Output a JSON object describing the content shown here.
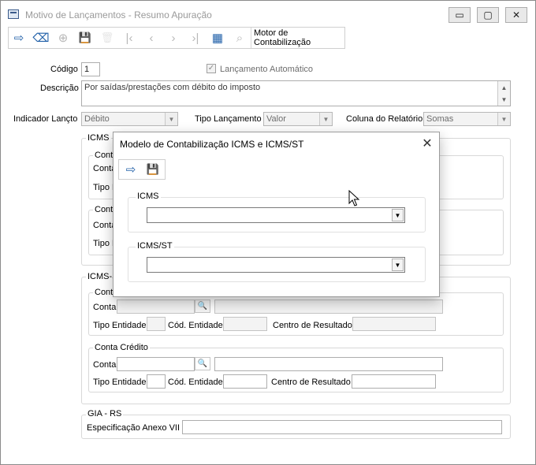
{
  "window": {
    "title": "Motivo de Lançamentos - Resumo Apuração",
    "minimize_glyph": "▭",
    "maximize_glyph": "▢",
    "close_glyph": "✕"
  },
  "toolbar": {
    "exit_icon": "⇨",
    "eraser_icon": "⌫",
    "add_icon": "⊕",
    "save_icon": "💾",
    "delete_icon": "🗑",
    "first_icon": "|‹",
    "prev_icon": "‹",
    "next_icon": "›",
    "last_icon": "›|",
    "grid_icon": "▦",
    "search_icon": "⌕",
    "motor_label": "Motor de Contabilização"
  },
  "form": {
    "codigo_label": "Código",
    "codigo_value": "1",
    "lancamento_automatico_label": "Lançamento Automático",
    "descricao_label": "Descrição",
    "descricao_value": "Por saídas/prestações com débito do imposto",
    "indicador_label": "Indicador Lançto",
    "indicador_value": "Débito",
    "tipo_lancamento_label": "Tipo Lançamento",
    "tipo_lancamento_value": "Valor",
    "coluna_relatorio_label": "Coluna do Relatório",
    "coluna_relatorio_value": "Somas"
  },
  "icms": {
    "title": "ICMS",
    "conta_debito_title": "Conta",
    "conta_label": "Conta",
    "tipo_label": "Tipo E",
    "conta_credito_title": "Cont",
    "conta_label2": "Conta",
    "tipo_label2": "Tipo E"
  },
  "icms_st": {
    "title": "ICMS-S",
    "debito_title": "Conta",
    "conta_label": "Conta",
    "tipo_entidade_label": "Tipo Entidade",
    "cod_entidade_label": "Cód. Entidade",
    "centro_resultado_label": "Centro de Resultado",
    "credito_title": "Conta Crédito",
    "conta_label2": "Conta",
    "tipo_entidade_label2": "Tipo Entidade",
    "cod_entidade_label2": "Cód. Entidade",
    "centro_resultado_label2": "Centro de Resultado"
  },
  "gia": {
    "title": "GIA - RS",
    "especificacao_label": "Especificação Anexo VII"
  },
  "modal": {
    "title": "Modelo de Contabilização ICMS e ICMS/ST",
    "close_glyph": "✕",
    "icms_label": "ICMS",
    "icms_st_label": "ICMS/ST",
    "dropdown_arrow": "▼"
  },
  "colors": {
    "accent": "#1f5fa8",
    "disabled_text": "#6d6d6d",
    "border": "#adadad"
  }
}
